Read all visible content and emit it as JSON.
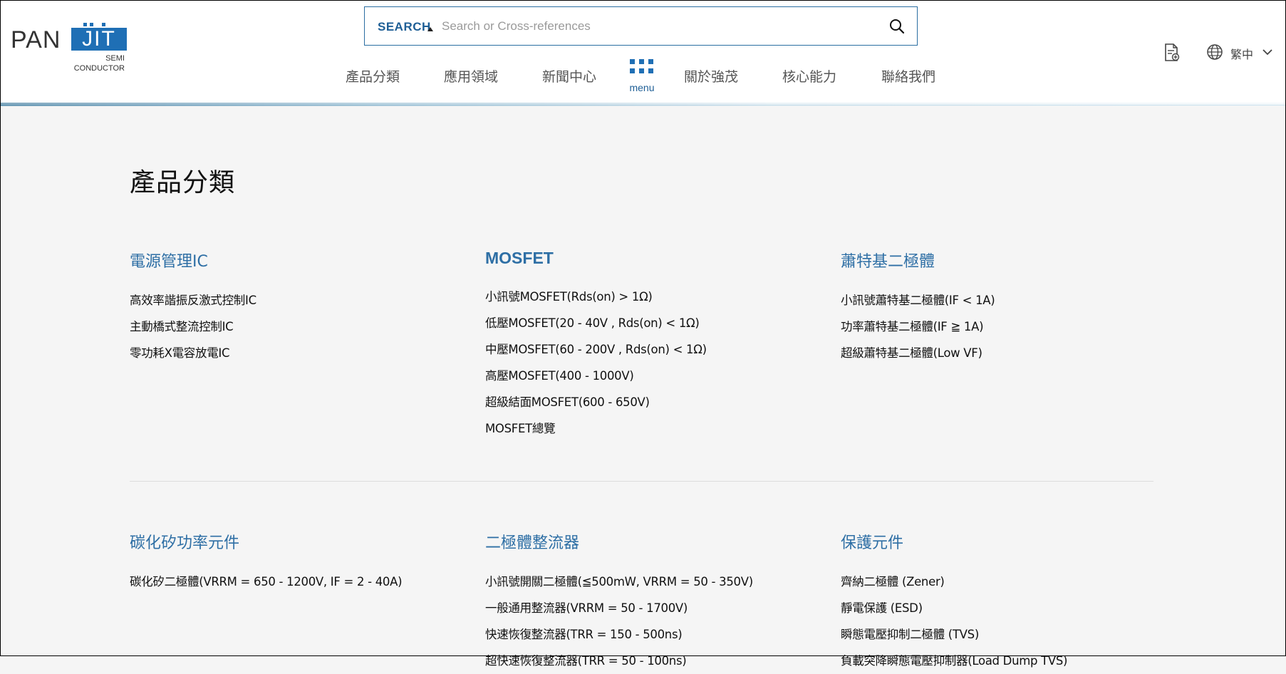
{
  "header": {
    "logo": {
      "text_main": "PAN",
      "text_box": "JIT",
      "sub_line1": "SEMI",
      "sub_line2": "CONDUCTOR"
    },
    "search": {
      "label": "SEARCH",
      "placeholder": "Search or Cross-references",
      "value": ""
    },
    "nav": [
      {
        "label": "產品分類"
      },
      {
        "label": "應用領域"
      },
      {
        "label": "新聞中心"
      },
      {
        "label": "關於強茂"
      },
      {
        "label": "核心能力"
      },
      {
        "label": "聯絡我們"
      }
    ],
    "menu_label": "menu",
    "language": "繁中",
    "accent_color": "#1f6fb5"
  },
  "main": {
    "title": "產品分類",
    "categories": [
      {
        "title": "電源管理IC",
        "items": [
          "高效率諧振反激式控制IC",
          "主動橋式整流控制IC",
          "零功耗X電容放電IC"
        ]
      },
      {
        "title": "MOSFET",
        "items": [
          "小訊號MOSFET(Rds(on) > 1Ω)",
          "低壓MOSFET(20 - 40V , Rds(on) < 1Ω)",
          "中壓MOSFET(60 - 200V , Rds(on) < 1Ω)",
          "高壓MOSFET(400 - 1000V)",
          "超級結面MOSFET(600 - 650V)",
          "MOSFET總覽"
        ]
      },
      {
        "title": "蕭特基二極體",
        "items": [
          "小訊號蕭特基二極體(IF < 1A)",
          "功率蕭特基二極體(IF ≧ 1A)",
          "超級蕭特基二極體(Low VF)"
        ]
      },
      {
        "title": "碳化矽功率元件",
        "items": [
          "碳化矽二極體(VRRM = 650 - 1200V, IF = 2 - 40A)"
        ]
      },
      {
        "title": "二極體整流器",
        "items": [
          "小訊號開關二極體(≦500mW, VRRM = 50 - 350V)",
          "一般通用整流器(VRRM = 50 - 1700V)",
          "快速恢復整流器(TRR = 150 - 500ns)",
          "超快速恢復整流器(TRR = 50 - 100ns)"
        ]
      },
      {
        "title": "保護元件",
        "items": [
          "齊納二極體 (Zener)",
          "靜電保護 (ESD)",
          "瞬態電壓抑制二極體 (TVS)",
          "負載突降瞬態電壓抑制器(Load Dump TVS)"
        ]
      }
    ]
  }
}
